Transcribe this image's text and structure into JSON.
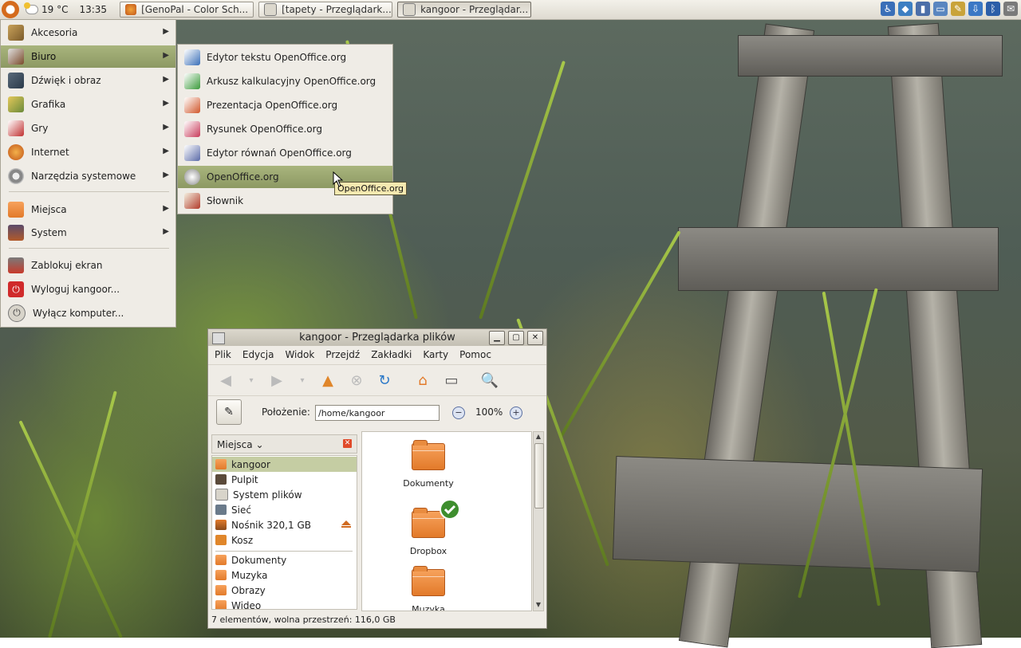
{
  "top_panel": {
    "temperature": "19 °C",
    "clock": "13:35",
    "tasks": [
      {
        "label": "[GenoPal - Color Sch..."
      },
      {
        "label": "[tapety - Przeglądark..."
      },
      {
        "label": "kangoor - Przeglądar..."
      }
    ]
  },
  "main_menu": {
    "items": [
      {
        "label": "Akcesoria"
      },
      {
        "label": "Biuro"
      },
      {
        "label": "Dźwięk i obraz"
      },
      {
        "label": "Grafika"
      },
      {
        "label": "Gry"
      },
      {
        "label": "Internet"
      },
      {
        "label": "Narzędzia systemowe"
      },
      {
        "label": "Miejsca"
      },
      {
        "label": "System"
      },
      {
        "label": "Zablokuj ekran"
      },
      {
        "label": "Wyloguj kangoor..."
      },
      {
        "label": "Wyłącz komputer..."
      }
    ]
  },
  "sub_menu": {
    "items": [
      {
        "label": "Edytor tekstu OpenOffice.org"
      },
      {
        "label": "Arkusz kalkulacyjny OpenOffice.org"
      },
      {
        "label": "Prezentacja OpenOffice.org"
      },
      {
        "label": "Rysunek OpenOffice.org"
      },
      {
        "label": "Edytor równań OpenOffice.org"
      },
      {
        "label": "OpenOffice.org"
      },
      {
        "label": "Słownik"
      }
    ],
    "tooltip": "OpenOffice.org"
  },
  "file_manager": {
    "title": "kangoor - Przeglądarka plików",
    "menus": [
      "Plik",
      "Edycja",
      "Widok",
      "Przejdź",
      "Zakładki",
      "Karty",
      "Pomoc"
    ],
    "location_label": "Położenie:",
    "location_value": "/home/kangoor",
    "zoom": "100%",
    "sidebar_title": "Miejsca",
    "places": [
      {
        "label": "kangoor"
      },
      {
        "label": "Pulpit"
      },
      {
        "label": "System plików"
      },
      {
        "label": "Sieć"
      },
      {
        "label": "Nośnik 320,1 GB"
      },
      {
        "label": "Kosz"
      }
    ],
    "bookmarks": [
      {
        "label": "Dokumenty"
      },
      {
        "label": "Muzyka"
      },
      {
        "label": "Obrazy"
      },
      {
        "label": "Wideo"
      }
    ],
    "folders": [
      {
        "label": "Dokumenty"
      },
      {
        "label": "Dropbox"
      },
      {
        "label": "Muzyka"
      }
    ],
    "status": "7 elementów, wolna przestrzeń: 116,0 GB"
  }
}
